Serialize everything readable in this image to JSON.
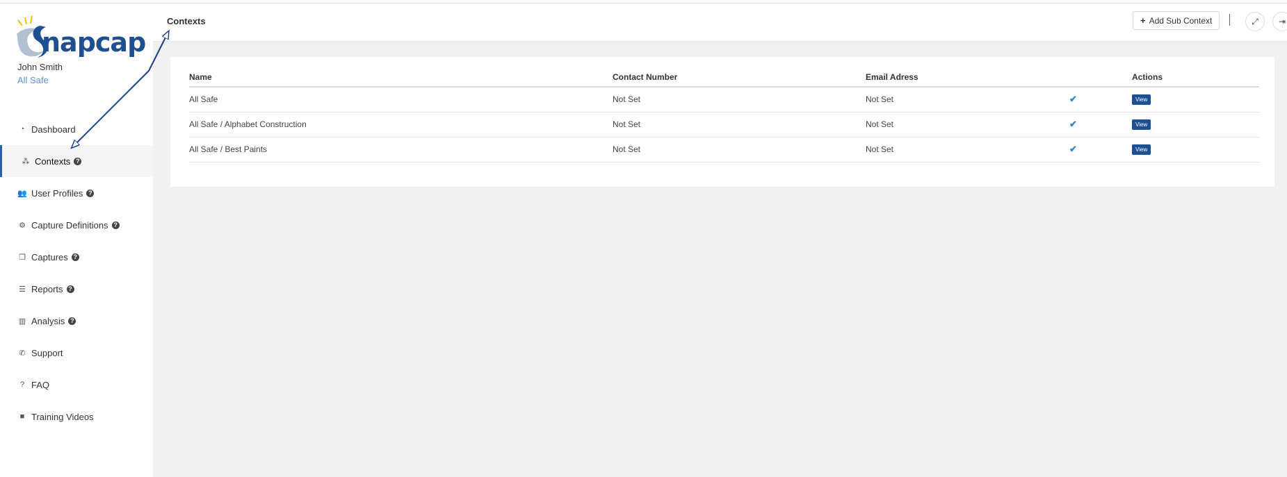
{
  "brand": {
    "name": "Snapcap",
    "logo_text": "napcap",
    "logo_initial": "S",
    "color": "#1d4f91"
  },
  "user": {
    "name": "John Smith",
    "organisation": "All Safe"
  },
  "sidebar": {
    "items": [
      {
        "label": "Dashboard",
        "icon": "dashboard-icon",
        "glyph": "◔",
        "help": false,
        "active": false
      },
      {
        "label": "Contexts",
        "icon": "cubes-icon",
        "glyph": "⁂",
        "help": true,
        "active": true
      },
      {
        "label": "User Profiles",
        "icon": "users-icon",
        "glyph": "👥",
        "help": true,
        "active": false
      },
      {
        "label": "Capture Definitions",
        "icon": "cogs-icon",
        "glyph": "⚙",
        "help": true,
        "active": false
      },
      {
        "label": "Captures",
        "icon": "copy-icon",
        "glyph": "❐",
        "help": true,
        "active": false
      },
      {
        "label": "Reports",
        "icon": "list-icon",
        "glyph": "☰",
        "help": true,
        "active": false
      },
      {
        "label": "Analysis",
        "icon": "bar-chart-icon",
        "glyph": "▥",
        "help": true,
        "active": false
      },
      {
        "label": "Support",
        "icon": "phone-icon",
        "glyph": "✆",
        "help": false,
        "active": false
      },
      {
        "label": "FAQ",
        "icon": "question-icon",
        "glyph": "?",
        "help": false,
        "active": false
      },
      {
        "label": "Training Videos",
        "icon": "video-camera-icon",
        "glyph": "■",
        "help": false,
        "active": false
      }
    ],
    "help_glyph": "?"
  },
  "header": {
    "title": "Contexts",
    "add_button_label": "Add Sub Context",
    "add_button_glyph": "+",
    "fullscreen_glyph": "⤢",
    "logout_glyph": "⇥"
  },
  "table": {
    "columns": [
      "Name",
      "Contact Number",
      "Email Adress",
      "",
      "Actions"
    ],
    "rows": [
      {
        "name": "All Safe",
        "contact": "Not Set",
        "email": "Not Set",
        "check": "✔",
        "action": "View"
      },
      {
        "name": "All Safe / Alphabet Construction",
        "contact": "Not Set",
        "email": "Not Set",
        "check": "✔",
        "action": "View"
      },
      {
        "name": "All Safe / Best Paints",
        "contact": "Not Set",
        "email": "Not Set",
        "check": "✔",
        "action": "View"
      }
    ]
  },
  "colors": {
    "accent": "#1d4f91",
    "active_border": "#2d5fa6",
    "check": "#2e86c9",
    "annotation_arrow": "#1c3f8a"
  }
}
